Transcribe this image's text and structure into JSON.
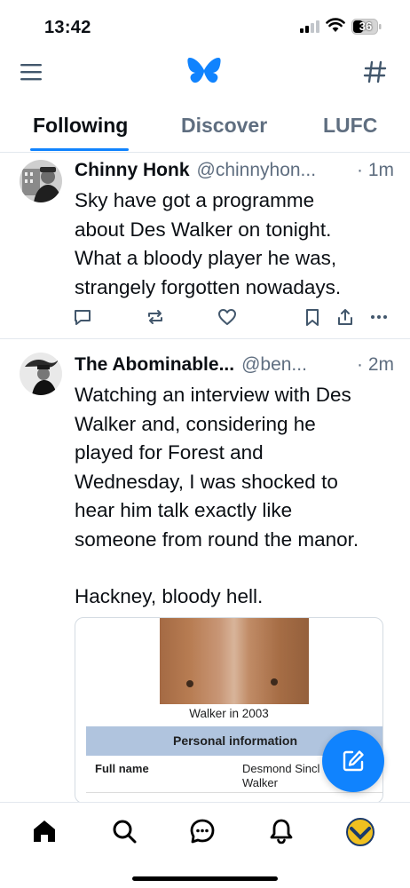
{
  "status_bar": {
    "time": "13:42",
    "battery": "36"
  },
  "tabs": [
    {
      "label": "Following",
      "active": true
    },
    {
      "label": "Discover",
      "active": false
    },
    {
      "label": "LUFC",
      "active": false
    }
  ],
  "posts": [
    {
      "display_name": "Chinny Honk",
      "handle": "@chinnyhon...",
      "time": "1m",
      "text": [
        "Sky have got a programme",
        "about Des Walker on tonight.",
        "What a bloody player he was,",
        "strangely forgotten nowadays."
      ]
    },
    {
      "display_name": "The Abominable...",
      "handle": "@ben...",
      "time": "2m",
      "paragraphs": [
        [
          "Watching an interview with Des",
          "Walker and, considering he",
          "played for Forest and",
          "Wednesday, I was shocked to",
          "hear him talk exactly like",
          "someone from round the manor."
        ],
        [
          "Hackney, bloody hell."
        ]
      ],
      "embed": {
        "caption": "Walker in 2003",
        "section_header": "Personal information",
        "field_label": "Full name",
        "field_value_line1": "Desmond Sincl",
        "field_value_line2": "Walker"
      }
    }
  ],
  "colors": {
    "accent": "#1083fe",
    "muted": "#5f6e80",
    "divider": "#e3e8ee"
  },
  "icons": {
    "top": [
      "menu-icon",
      "butterfly-logo-icon",
      "hashtag-icon"
    ],
    "post_actions": [
      "reply-icon",
      "repost-icon",
      "like-icon",
      "bookmark-icon",
      "share-icon",
      "more-icon"
    ],
    "bottom_nav": [
      "home-icon",
      "search-icon",
      "chat-icon",
      "notifications-icon",
      "profile-avatar"
    ],
    "fab": "compose-icon"
  }
}
